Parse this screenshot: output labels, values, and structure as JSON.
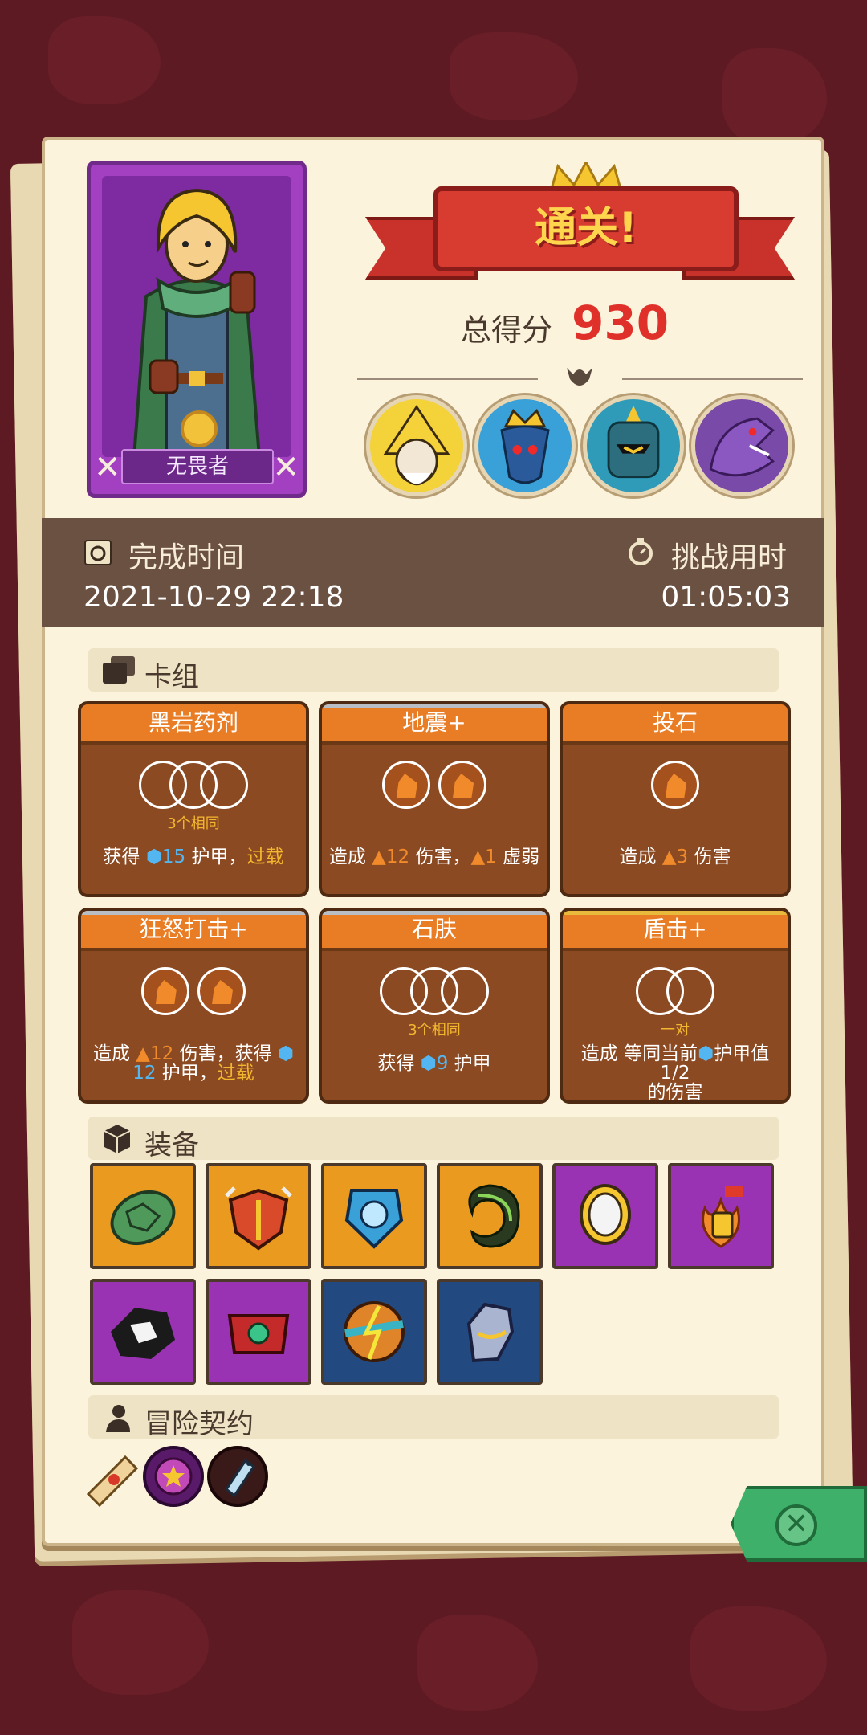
{
  "hero": {
    "name": "无畏者"
  },
  "result": {
    "title": "通关!",
    "score_label": "总得分",
    "score_value": "930"
  },
  "bosses": [
    {
      "name": "yellow-wizard-boss"
    },
    {
      "name": "blue-crowned-boss"
    },
    {
      "name": "teal-knight-boss"
    },
    {
      "name": "purple-dragon-boss"
    }
  ],
  "time": {
    "finish_label": "完成时间",
    "finish_value": "2021-10-29 22:18",
    "duration_label": "挑战用时",
    "duration_value": "01:05:03"
  },
  "sections": {
    "deck": "卡组",
    "equipment": "装备",
    "contracts": "冒险契约"
  },
  "cards": [
    {
      "title": "黑岩药剂",
      "note": "3个相同",
      "desc_a": "获得 ",
      "num1": "15",
      "desc_b": " 护甲，",
      "desc_c": "过载"
    },
    {
      "title": "地震+",
      "desc_a": "造成 ",
      "num1": "12",
      "desc_b": " 伤害，",
      "num2": "1",
      "desc_c": " 虚弱"
    },
    {
      "title": "投石",
      "desc_a": "造成 ",
      "num1": "3",
      "desc_b": " 伤害"
    },
    {
      "title": "狂怒打击+",
      "desc_a": "造成 ",
      "num1": "12",
      "desc_b": " 伤害，获得 ",
      "num2": "12",
      "desc_c": " 护甲，",
      "desc_d": "过载"
    },
    {
      "title": "石肤",
      "note": "3个相同",
      "desc_a": "获得 ",
      "num1": "9",
      "desc_b": " 护甲"
    },
    {
      "title": "盾击+",
      "note": "一对",
      "desc_a": "造成 等同当前",
      "desc_b": "护甲值1/2",
      "desc_c": "的伤害"
    }
  ],
  "equipment": [
    {
      "rarity": "orange",
      "icon": "turtle-shell-icon"
    },
    {
      "rarity": "orange",
      "icon": "spiked-armor-icon"
    },
    {
      "rarity": "orange",
      "icon": "ice-shield-icon"
    },
    {
      "rarity": "orange",
      "icon": "horn-ring-icon"
    },
    {
      "rarity": "purple",
      "icon": "mirror-icon"
    },
    {
      "rarity": "purple",
      "icon": "fire-potion-icon"
    },
    {
      "rarity": "purple",
      "icon": "shattered-stone-icon"
    },
    {
      "rarity": "purple",
      "icon": "red-belt-icon"
    },
    {
      "rarity": "blue",
      "icon": "lightning-orb-icon"
    },
    {
      "rarity": "blue",
      "icon": "gauntlet-icon"
    }
  ],
  "contracts": [
    {
      "icon": "scroll-icon"
    },
    {
      "icon": "purple-seal-icon"
    },
    {
      "icon": "tag-charm-icon"
    }
  ],
  "colors": {
    "orange": "#e99a1f",
    "purple": "#9a33b3",
    "blue": "#234a80",
    "card": "#8c4a22",
    "card_title": "#e87d25"
  }
}
